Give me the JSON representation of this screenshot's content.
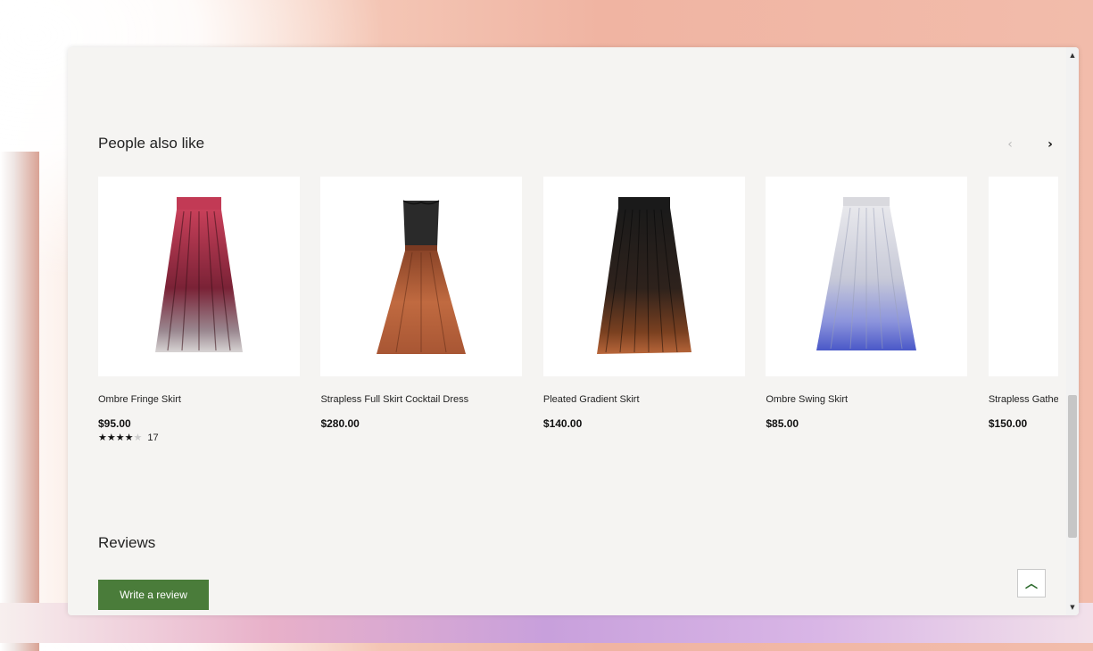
{
  "section": {
    "title": "People also like"
  },
  "carousel": {
    "prev_icon": "chevron-left-icon",
    "next_icon": "chevron-right-icon",
    "prev_glyph": "‹",
    "next_glyph": "›"
  },
  "products": [
    {
      "name": "Ombre Fringe Skirt",
      "price": "$95.00",
      "rating": 4,
      "rating_max": 5,
      "review_count": "17"
    },
    {
      "name": "Strapless Full Skirt Cocktail Dress",
      "price": "$280.00"
    },
    {
      "name": "Pleated Gradient Skirt",
      "price": "$140.00"
    },
    {
      "name": "Ombre Swing Skirt",
      "price": "$85.00"
    },
    {
      "name": "Strapless Gathere",
      "price": "$150.00"
    }
  ],
  "reviews": {
    "title": "Reviews",
    "write_button": "Write a review"
  },
  "back_to_top": {
    "icon": "chevron-up-icon",
    "glyph": "︿"
  },
  "colors": {
    "accent_green": "#4a7c3a",
    "background": "#f5f4f2"
  }
}
